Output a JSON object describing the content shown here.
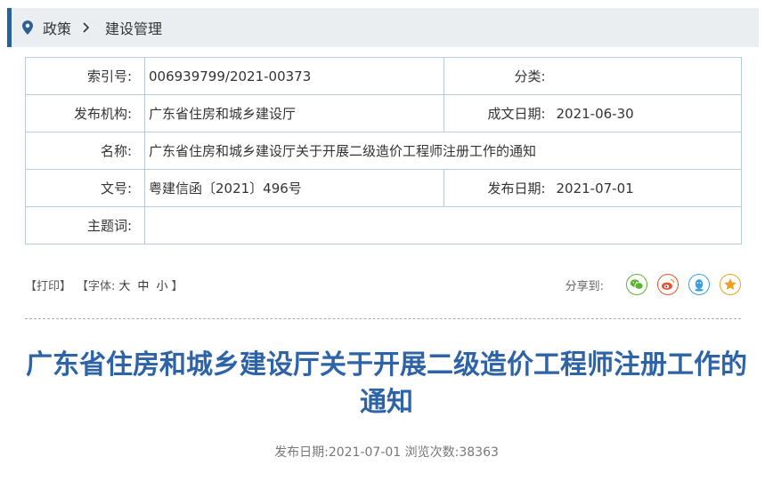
{
  "breadcrumb": {
    "home": "政策",
    "current": "建设管理"
  },
  "meta": {
    "index_label": "索引号:",
    "index_value": "006939799/2021-00373",
    "category_label": "分类:",
    "category_value": "",
    "issuer_label": "发布机构:",
    "issuer_value": "广东省住房和城乡建设厅",
    "created_label": "成文日期:",
    "created_value": "2021-06-30",
    "name_label": "名称:",
    "name_value": "广东省住房和城乡建设厅关于开展二级造价工程师注册工作的通知",
    "docno_label": "文号:",
    "docno_value": "粤建信函〔2021〕496号",
    "published_label": "发布日期:",
    "published_value": "2021-07-01",
    "keywords_label": "主题词:",
    "keywords_value": ""
  },
  "toolbar": {
    "print": "【打印】",
    "font_open": "【字体:",
    "font_large": "大",
    "font_medium": "中",
    "font_small": "小",
    "font_close": "】",
    "share_label": "分享到:",
    "share_icons": [
      "wechat-icon",
      "weibo-icon",
      "qq-icon",
      "qzone-icon"
    ]
  },
  "article": {
    "title": "广东省住房和城乡建设厅关于开展二级造价工程师注册工作的通知",
    "pub_info": "发布日期:2021-07-01  浏览次数:38363"
  },
  "colors": {
    "accent": "#2c5f93",
    "title": "#2e64a7",
    "wechat": "#5cb531",
    "weibo": "#e6532e",
    "qq": "#3aa0e0",
    "qzone": "#f0a020"
  }
}
